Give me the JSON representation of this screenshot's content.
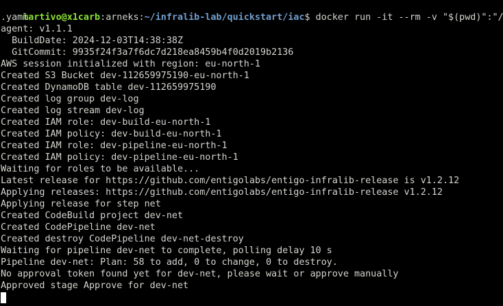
{
  "prompt": {
    "user_host": "martivo@x1carb",
    "sep1": ":",
    "cwd_label": "arneks:",
    "path": "~/infralib-lab/quickstart/iac",
    "symbol": "$ ",
    "command": "docker run -it --rm -v \"$(pwd)\":\"/conf\"",
    "command_wrap": ".yaml"
  },
  "output_lines": [
    "agent: v1.1.1",
    "  BuildDate: 2024-12-03T14:38:38Z",
    "  GitCommit: 9935f24f3a7f6dc7d218ea8459b4f0d2019b2136",
    "AWS session initialized with region: eu-north-1",
    "Created S3 Bucket dev-112659975190-eu-north-1",
    "Created DynamoDB table dev-112659975190",
    "Created log group dev-log",
    "Created log stream dev-log",
    "Created IAM role: dev-build-eu-north-1",
    "Created IAM policy: dev-build-eu-north-1",
    "Created IAM role: dev-pipeline-eu-north-1",
    "Created IAM policy: dev-pipeline-eu-north-1",
    "Waiting for roles to be available...",
    "Latest release for https://github.com/entigolabs/entigo-infralib-release is v1.2.12",
    "Applying releases: https://github.com/entigolabs/entigo-infralib-release v1.2.12",
    "Applying release for step net",
    "Created CodeBuild project dev-net",
    "Created CodePipeline dev-net",
    "Created destroy CodePipeline dev-net-destroy",
    "Waiting for pipeline dev-net to complete, polling delay 10 s",
    "Pipeline dev-net: Plan: 58 to add, 0 to change, 0 to destroy.",
    "No approval token found yet for dev-net, please wait or approve manually",
    "Approved stage Approve for dev-net"
  ],
  "colors": {
    "background": "#000000",
    "text": "#d3d7cf",
    "user_host": "#8ae234",
    "path": "#729fcf",
    "cursor": "#ffffff"
  }
}
